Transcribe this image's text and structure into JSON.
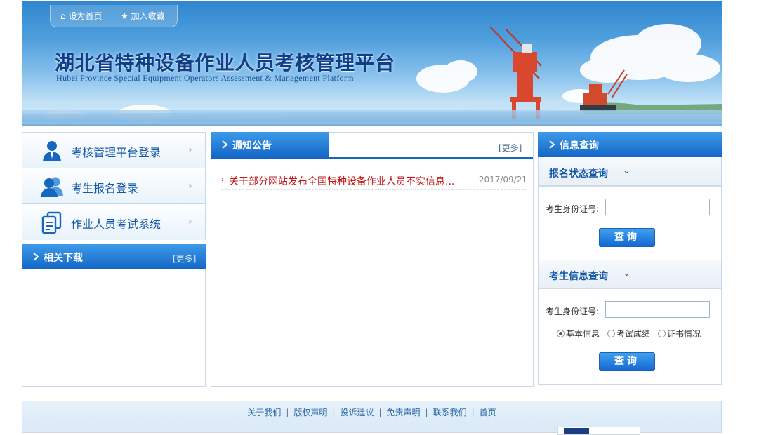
{
  "topbar": {
    "home_label": "设为首页",
    "fav_label": "加入收藏"
  },
  "site": {
    "title": "湖北省特种设备作业人员考核管理平台",
    "subtitle": "Hubei Province Special Equipment Operators Assessment & Management Platform"
  },
  "login_links": [
    {
      "label": "考核管理平台登录",
      "icon": "person-icon"
    },
    {
      "label": "考生报名登录",
      "icon": "users-icon"
    },
    {
      "label": "作业人员考试系统",
      "icon": "documents-icon"
    }
  ],
  "downloads": {
    "title": "相关下载",
    "more": "[更多]"
  },
  "notice": {
    "title": "通知公告",
    "more": "[更多]",
    "items": [
      {
        "title": "关于部分网站发布全国特种设备作业人员不实信息...",
        "date": "2017/09/21"
      }
    ]
  },
  "query": {
    "title": "信息查询",
    "status_section": {
      "title": "报名状态查询",
      "id_label": "考生身份证号:",
      "id_value": "",
      "button": "查询"
    },
    "info_section": {
      "title": "考生信息查询",
      "id_label": "考生身份证号:",
      "id_value": "",
      "options": [
        "基本信息",
        "考试成绩",
        "证书情况"
      ],
      "selected_option": "基本信息",
      "button": "查询"
    }
  },
  "footer": {
    "links": [
      "关于我们",
      "版权声明",
      "投诉建议",
      "免责声明",
      "联系我们",
      "首页"
    ]
  },
  "colors": {
    "primary_blue": "#1366c6",
    "link_blue": "#1458a8",
    "notice_red": "#c01818",
    "header_navy": "#103e88"
  }
}
